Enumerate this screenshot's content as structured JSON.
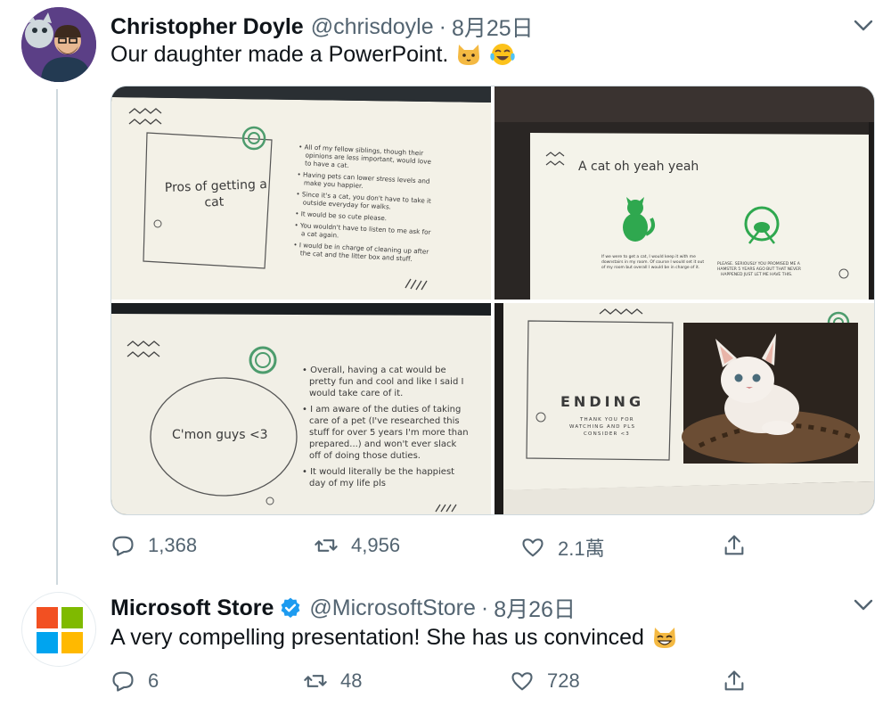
{
  "tweet1": {
    "name": "Christopher Doyle",
    "handle": "@chrisdoyle",
    "separator": "·",
    "date": "8月25日",
    "text": "Our daughter made a PowerPoint.",
    "emojis": [
      "cat-face-emoji",
      "tears-of-joy-emoji"
    ],
    "slides": {
      "slide1": {
        "box_title": "Pros of getting a cat",
        "bullets": [
          "All of my fellow siblings, though their opinions are less important, would love to have a cat.",
          "Having pets can lower stress levels and make you happier.",
          "Since it's a cat, you don't have to take it outside everyday for walks.",
          "It would be so cute please.",
          "You wouldn't have to listen to me ask for a cat again.",
          "I would be in charge of cleaning up after the cat and the litter box and stuff."
        ]
      },
      "slide2": {
        "title": "A cat oh yeah yeah",
        "left_caption": "If we were to get a cat, I would keep it with me downstairs in my room. Of course I would set it out of my room but overall I would be in charge of it.",
        "right_caption": "PLEASE. SERIOUSLY YOU PROMISED ME A HAMSTER 5 YEARS AGO BUT THAT NEVER HAPPENED JUST LET ME HAVE THIS."
      },
      "slide3": {
        "circle_title": "C'mon guys <3",
        "bullets": [
          "Overall, having a cat would be pretty fun and cool and like I said I would take care of it.",
          "I am aware of the duties of taking care of a pet (I've researched this stuff for over 5 years I'm more than prepared...) and won't ever slack off of doing those duties.",
          "It would literally be the happiest day of my life pls"
        ]
      },
      "slide4": {
        "title": "ENDING",
        "subtitle": "THANK YOU FOR WATCHING AND PLS CONSIDER <3"
      }
    },
    "actions": {
      "reply_count": "1,368",
      "retweet_count": "4,956",
      "like_count": "2.1萬"
    }
  },
  "tweet2": {
    "name": "Microsoft Store",
    "handle": "@MicrosoftStore",
    "separator": "·",
    "date": "8月26日",
    "text": "A very compelling presentation! She has us convinced",
    "emojis": [
      "grinning-cat-emoji"
    ],
    "actions": {
      "reply_count": "6",
      "retweet_count": "48",
      "like_count": "728"
    }
  },
  "colors": {
    "verified_blue": "#1d9bf0",
    "secondary_text": "#536471",
    "ms_red": "#f25022",
    "ms_green": "#7fba00",
    "ms_blue": "#00a4ef",
    "ms_yellow": "#ffb900",
    "slide_green": "#2fa84f"
  }
}
